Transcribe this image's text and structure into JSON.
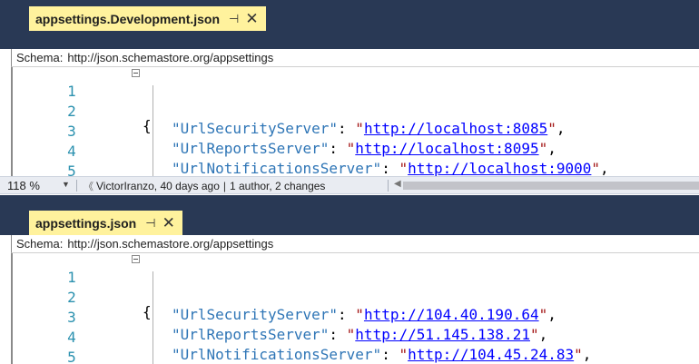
{
  "panes": [
    {
      "tab": {
        "title": "appsettings.Development.json",
        "pin_icon": "pin-icon",
        "close_icon": "close-icon",
        "close_glyph": "✕",
        "pin_glyph": "⊣"
      },
      "schema": {
        "label": "Schema:",
        "value": "http://json.schemastore.org/appsettings"
      },
      "lines": [
        {
          "num": "1",
          "brace": "{"
        },
        {
          "num": "2",
          "key": "\"UrlSecurityServer\"",
          "sep": ": ",
          "q1": "\"",
          "url": "http://localhost:8085",
          "q2": "\"",
          "tail": ","
        },
        {
          "num": "3",
          "key": "\"UrlReportsServer\"",
          "sep": ": ",
          "q1": "\"",
          "url": "http://localhost:8095",
          "q2": "\"",
          "tail": ","
        },
        {
          "num": "4",
          "key": "\"UrlNotificationsServer\"",
          "sep": ": ",
          "q1": "\"",
          "url": "http://localhost:9000",
          "q2": "\"",
          "tail": ","
        },
        {
          "num": "5"
        }
      ],
      "status": {
        "zoom": "118 %",
        "blame_author": "VictorIranzo, 40 days ago",
        "blame_summary": "1 author, 2 changes",
        "divider": "|"
      }
    },
    {
      "tab": {
        "title": "appsettings.json",
        "pin_icon": "pin-icon",
        "close_icon": "close-icon",
        "close_glyph": "✕",
        "pin_glyph": "⊣"
      },
      "schema": {
        "label": "Schema:",
        "value": "http://json.schemastore.org/appsettings"
      },
      "lines": [
        {
          "num": "1",
          "brace": "{"
        },
        {
          "num": "2",
          "key": "\"UrlSecurityServer\"",
          "sep": ": ",
          "q1": "\"",
          "url": "http://104.40.190.64",
          "q2": "\"",
          "tail": ","
        },
        {
          "num": "3",
          "key": "\"UrlReportsServer\"",
          "sep": ": ",
          "q1": "\"",
          "url": "http://51.145.138.21",
          "q2": "\"",
          "tail": ","
        },
        {
          "num": "4",
          "key": "\"UrlNotificationsServer\"",
          "sep": ": ",
          "q1": "\"",
          "url": "http://104.45.24.83",
          "q2": "\"",
          "tail": ","
        },
        {
          "num": "5"
        }
      ]
    }
  ],
  "colors": {
    "tabbar": "#293955",
    "active_tab": "#fff29d",
    "line_number": "#2b91af",
    "json_key": "#2e75b6",
    "json_string": "#a31515",
    "url_link": "#0000ff"
  }
}
